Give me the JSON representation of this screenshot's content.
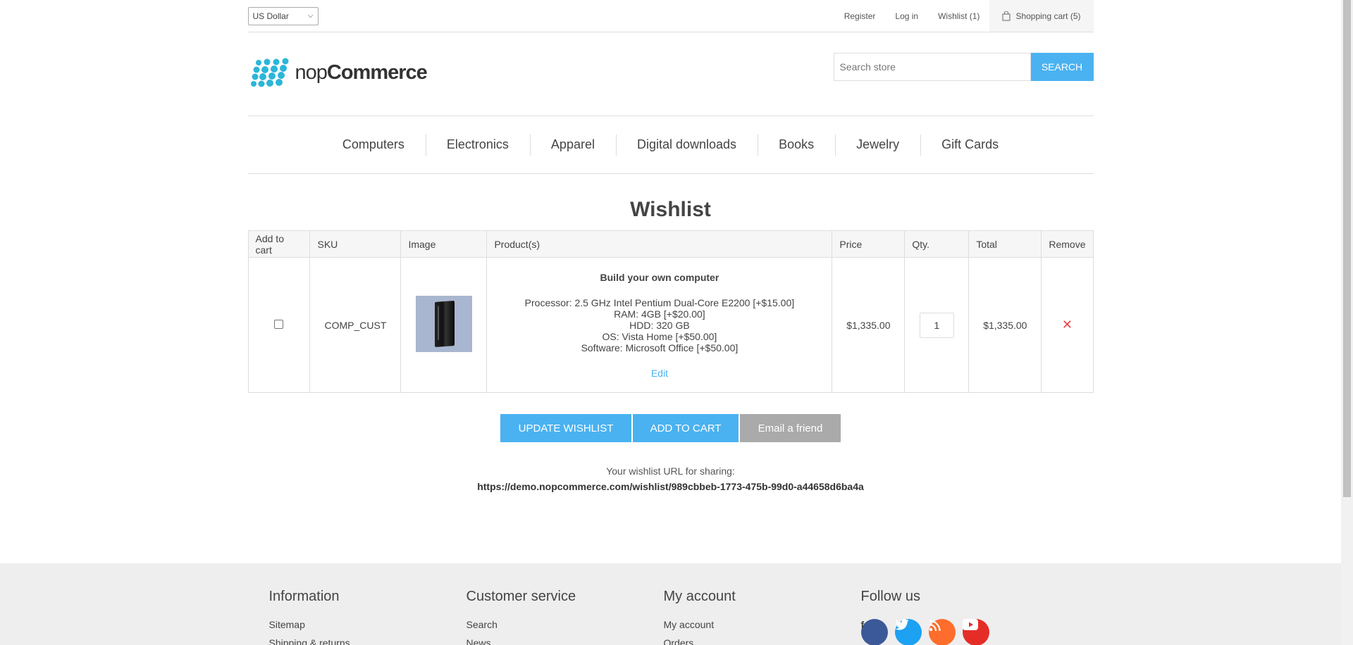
{
  "header": {
    "currency": "US Dollar",
    "links": {
      "register": "Register",
      "login": "Log in",
      "wishlist": "Wishlist (1)",
      "cart": "Shopping cart (5)"
    }
  },
  "logo": {
    "text_light": "nop",
    "text_bold": "Commerce"
  },
  "search": {
    "placeholder": "Search store",
    "button": "SEARCH"
  },
  "menu": [
    "Computers",
    "Electronics",
    "Apparel",
    "Digital downloads",
    "Books",
    "Jewelry",
    "Gift Cards"
  ],
  "wishlist": {
    "title": "Wishlist",
    "columns": [
      "Add to cart",
      "SKU",
      "Image",
      "Product(s)",
      "Price",
      "Qty.",
      "Total",
      "Remove"
    ],
    "item": {
      "sku": "COMP_CUST",
      "name": "Build your own computer",
      "attributes": [
        "Processor: 2.5 GHz Intel Pentium Dual-Core E2200 [+$15.00]",
        "RAM: 4GB [+$20.00]",
        "HDD: 320 GB",
        "OS: Vista Home [+$50.00]",
        "Software: Microsoft Office [+$50.00]"
      ],
      "edit": "Edit",
      "price": "$1,335.00",
      "qty": "1",
      "total": "$1,335.00",
      "remove": "✕"
    },
    "buttons": {
      "update": "UPDATE WISHLIST",
      "add": "ADD TO CART",
      "email": "Email a friend"
    },
    "share_label": "Your wishlist URL for sharing:",
    "share_url": "https://demo.nopcommerce.com/wishlist/989cbbeb-1773-475b-99d0-a44658d6ba4a"
  },
  "footer": {
    "info": {
      "title": "Information",
      "links": [
        "Sitemap",
        "Shipping & returns"
      ]
    },
    "service": {
      "title": "Customer service",
      "links": [
        "Search",
        "News"
      ]
    },
    "account": {
      "title": "My account",
      "links": [
        "My account",
        "Orders"
      ]
    },
    "follow": {
      "title": "Follow us"
    }
  },
  "colors": {
    "accent": "#4ab2f1",
    "remove": "#e4434b",
    "facebook": "#3b5998",
    "twitter": "#1da1f2",
    "rss": "#fe6d2b",
    "youtube": "#e52d27"
  }
}
